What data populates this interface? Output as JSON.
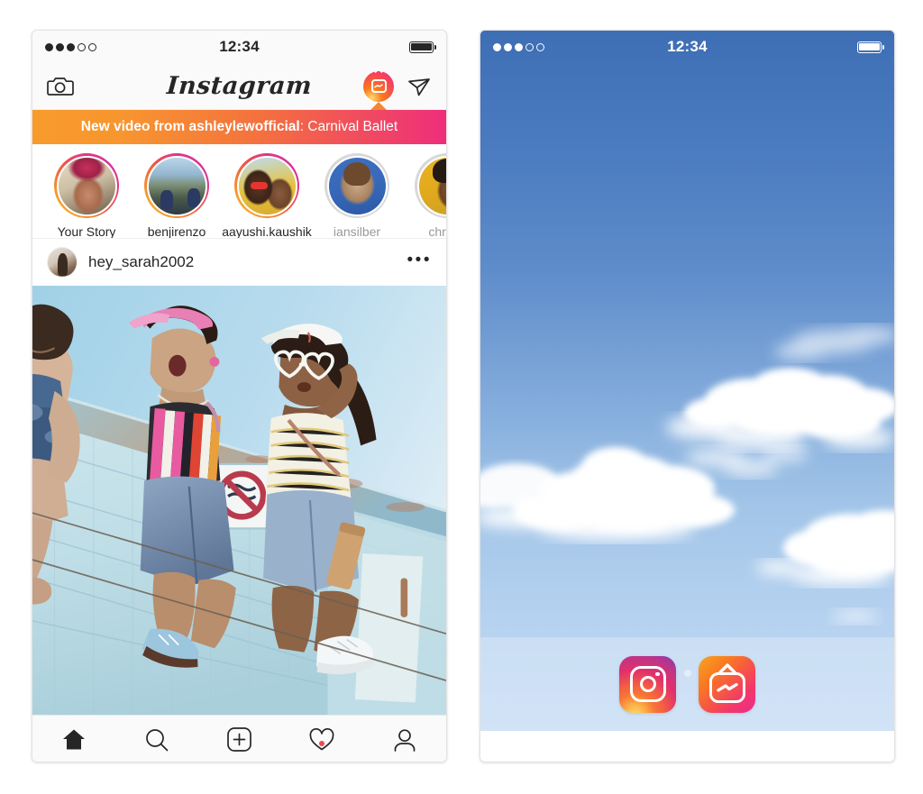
{
  "left_phone": {
    "status_bar": {
      "signal_filled": 3,
      "signal_empty": 2,
      "time": "12:34",
      "battery_full": true
    },
    "nav": {
      "camera_icon": "camera-icon",
      "logo_text": "Instagram",
      "igtv_icon": "igtv-badge-icon",
      "direct_icon": "direct-message-icon"
    },
    "banner": {
      "bold_text": "New video from ashleylewofficial",
      "regular_text": ": Carnival Ballet",
      "gradient_from": "#F89B2C",
      "gradient_to": "#EE2E7B"
    },
    "stories": [
      {
        "name": "Your Story",
        "state": "unseen",
        "art": "av1"
      },
      {
        "name": "benjirenzo",
        "state": "unseen",
        "art": "av2"
      },
      {
        "name": "aayushi.kaushik",
        "state": "unseen",
        "art": "av3"
      },
      {
        "name": "iansilber",
        "state": "seen",
        "art": "av4"
      },
      {
        "name": "christe",
        "state": "seen",
        "art": "av5"
      }
    ],
    "post": {
      "username": "hey_sarah2002",
      "more_label": "•••",
      "photo_alt": "Three friends sitting on the edge of a light-blue lifeguard tower on a sunny day"
    },
    "tabs": [
      {
        "name": "home",
        "icon": "home-icon",
        "active": true,
        "badge": false
      },
      {
        "name": "search",
        "icon": "search-icon",
        "active": false,
        "badge": false
      },
      {
        "name": "add",
        "icon": "plus-square-icon",
        "active": false,
        "badge": false
      },
      {
        "name": "activity",
        "icon": "heart-icon",
        "active": false,
        "badge": true
      },
      {
        "name": "profile",
        "icon": "person-icon",
        "active": false,
        "badge": false
      }
    ]
  },
  "right_phone": {
    "status_bar": {
      "signal_filled": 3,
      "signal_empty": 2,
      "time": "12:34",
      "battery_full": true
    },
    "wallpaper": "blue sky with white clouds",
    "page_dots": {
      "count": 3,
      "active_index": 0
    },
    "dock_apps": [
      {
        "name": "Instagram",
        "icon": "instagram-app-icon"
      },
      {
        "name": "IGTV",
        "icon": "igtv-app-icon"
      }
    ]
  }
}
